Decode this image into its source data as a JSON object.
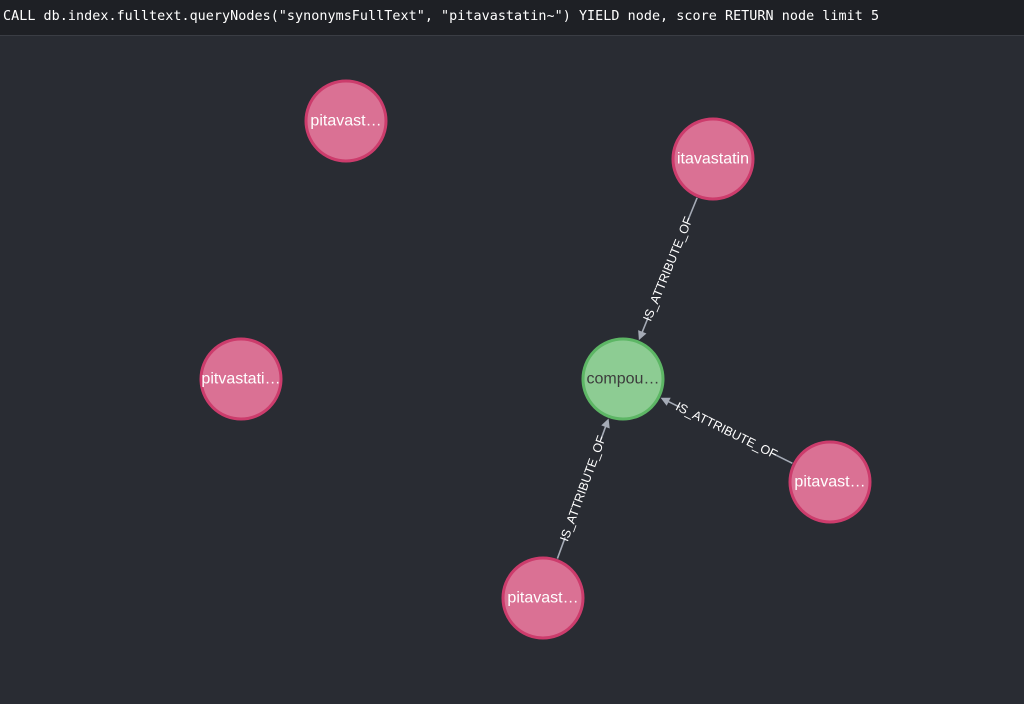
{
  "query": {
    "text": "CALL db.index.fulltext.queryNodes(\"synonymsFullText\", \"pitavastatin~\") YIELD node, score RETURN node limit 5"
  },
  "colors": {
    "background": "#292c33",
    "query_bar": "#1e2025",
    "node_synonym_fill": "#da7194",
    "node_synonym_stroke": "#cc3c6c",
    "node_compound_fill": "#8dcc93",
    "node_compound_stroke": "#5db665",
    "relationship": "#a5abb6"
  },
  "graph": {
    "nodes": [
      {
        "id": "n1",
        "label": "pitavast…",
        "kind": "synonym"
      },
      {
        "id": "n2",
        "label": "itavastatin",
        "kind": "synonym"
      },
      {
        "id": "n3",
        "label": "pitvastati…",
        "kind": "synonym"
      },
      {
        "id": "n4",
        "label": "compou…",
        "kind": "compound"
      },
      {
        "id": "n5",
        "label": "pitavast…",
        "kind": "synonym"
      },
      {
        "id": "n6",
        "label": "pitavast…",
        "kind": "synonym"
      }
    ],
    "relationships": [
      {
        "id": "r1",
        "from": "n2",
        "to": "n4",
        "type": "IS_ATTRIBUTE_OF"
      },
      {
        "id": "r2",
        "from": "n5",
        "to": "n4",
        "type": "IS_ATTRIBUTE_OF"
      },
      {
        "id": "r3",
        "from": "n6",
        "to": "n4",
        "type": "IS_ATTRIBUTE_OF"
      }
    ]
  }
}
